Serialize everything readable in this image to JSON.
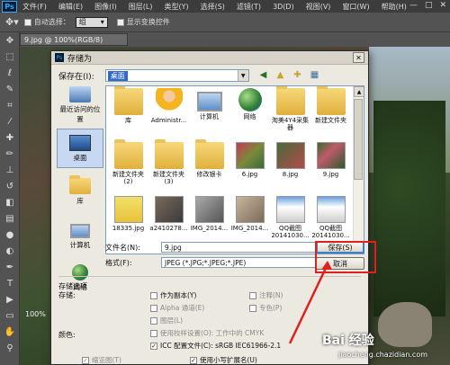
{
  "ps": {
    "logo": "Ps",
    "menu": [
      "文件(F)",
      "编辑(E)",
      "图像(I)",
      "图层(L)",
      "类型(Y)",
      "选择(S)",
      "滤镜(T)",
      "3D(D)",
      "视图(V)",
      "窗口(W)",
      "帮助(H)"
    ],
    "win_controls": [
      "—",
      "□",
      "✕"
    ],
    "options": {
      "auto_select_label": "自动选择：",
      "auto_select_value": "组",
      "show_transform_label": "显示变换控件"
    },
    "doc_tab": "9.jpg @ 100%(RGB/8)",
    "zoom": "100%"
  },
  "dialog": {
    "title": "存储为",
    "icon_text": "Ps",
    "close_symbol": "✕",
    "save_in_label": "保存在(I):",
    "save_in_value": "桌面",
    "places": [
      "最近访问的位置",
      "桌面",
      "库",
      "计算机",
      "网络"
    ],
    "files": [
      {
        "name": "库",
        "icon": "folder"
      },
      {
        "name": "Administr...",
        "icon": "person"
      },
      {
        "name": "计算机",
        "icon": "computer"
      },
      {
        "name": "网络",
        "icon": "globe"
      },
      {
        "name": "淘美4Y4采集器",
        "icon": "folder"
      },
      {
        "name": "新建文件夹",
        "icon": "folder"
      },
      {
        "name": "新建文件夹 (2)",
        "icon": "folder"
      },
      {
        "name": "新建文件夹 (3)",
        "icon": "folder"
      },
      {
        "name": "修改银卡",
        "icon": "folder"
      },
      {
        "name": "6.jpg",
        "icon": "photo-p1"
      },
      {
        "name": "8.jpg",
        "icon": "photo-p2"
      },
      {
        "name": "9.jpg",
        "icon": "photo-p3"
      },
      {
        "name": "18335.jpg",
        "icon": "photo-p4"
      },
      {
        "name": "a2410278...",
        "icon": "photo-p5"
      },
      {
        "name": "IMG_2014...",
        "icon": "photo-p6"
      },
      {
        "name": "IMG_2014...",
        "icon": "photo-p7"
      },
      {
        "name": "QQ截图 20141030...",
        "icon": "photo-p8"
      },
      {
        "name": "QQ截图 20141030...",
        "icon": "photo-p8"
      }
    ],
    "filename_label": "文件名(N):",
    "filename_value": "9.jpg",
    "format_label": "格式(F):",
    "format_value": "JPEG (*.JPG;*.JPEG;*.JPE)",
    "save_button": "保存(S)",
    "cancel_button": "取消",
    "save_options_title": "存储选项",
    "save_label": "存储:",
    "save_options": [
      {
        "label": "作为副本(Y)",
        "checked": false,
        "disabled": false
      },
      {
        "label": "注释(N)",
        "checked": false,
        "disabled": true
      },
      {
        "label": "Alpha 通道(E)",
        "checked": false,
        "disabled": true
      },
      {
        "label": "专色(P)",
        "checked": false,
        "disabled": true
      },
      {
        "label": "图层(L)",
        "checked": false,
        "disabled": true
      }
    ],
    "color_label": "颜色:",
    "color_options": [
      {
        "label": "使用校样设置(O): 工作中的 CMYK",
        "checked": false,
        "disabled": true
      },
      {
        "label": "ICC 配置文件(C): sRGB IEC61966-2.1",
        "checked": true,
        "disabled": false
      }
    ],
    "bottom_options": [
      {
        "label": "缩览图(T)",
        "checked": true,
        "disabled": true
      },
      {
        "label": "使用小写扩展名(U)",
        "checked": true,
        "disabled": false
      }
    ],
    "dropdown_arrow": "▼",
    "check_mark": "✓"
  },
  "watermark": {
    "main": "Bai 经验",
    "sub": "jiaocheng.chazidian.com"
  },
  "colors": {
    "annotation": "#e02020",
    "accent": "#316ac5"
  }
}
